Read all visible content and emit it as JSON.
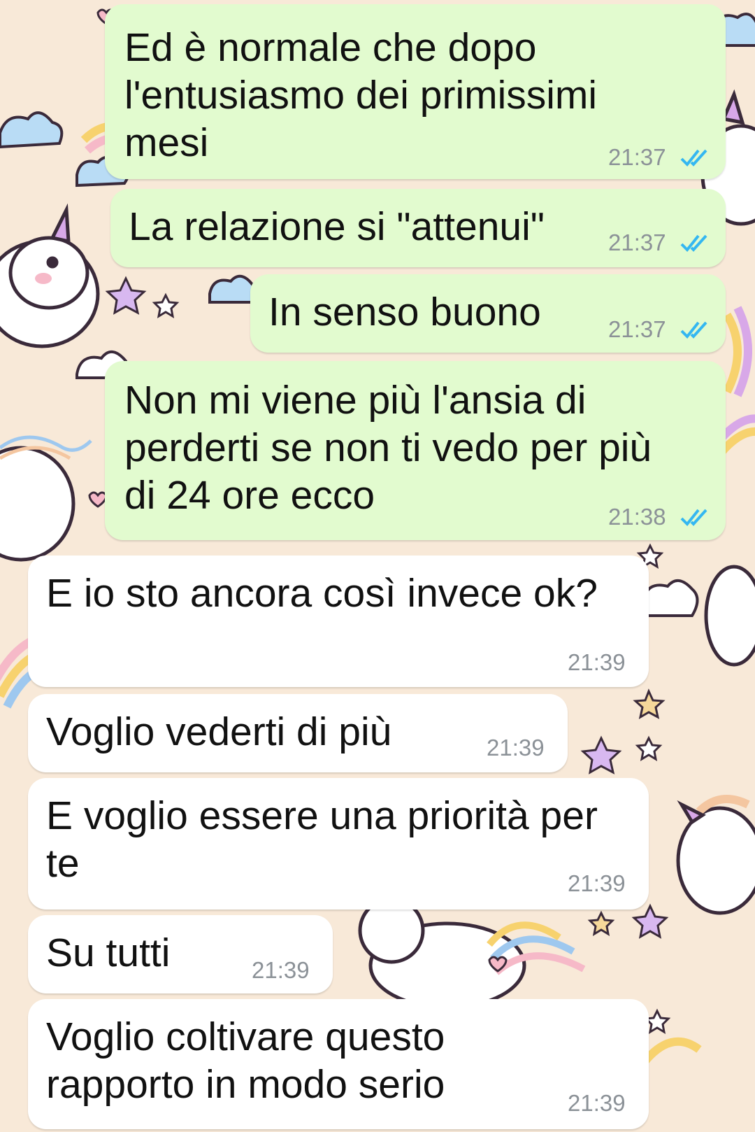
{
  "conversation": {
    "messages": [
      {
        "direction": "outgoing",
        "text": "Ed è normale che dopo\nl'entusiasmo dei primissimi\nmesi",
        "time": "21:37",
        "status": "read",
        "status_icon": "double-check-icon"
      },
      {
        "direction": "outgoing",
        "text": "La relazione si \"attenui\"",
        "time": "21:37",
        "status": "read",
        "status_icon": "double-check-icon"
      },
      {
        "direction": "outgoing",
        "text": "In senso buono",
        "time": "21:37",
        "status": "read",
        "status_icon": "double-check-icon"
      },
      {
        "direction": "outgoing",
        "text": "Non mi viene più l'ansia di\nperderti se non ti vedo per più\ndi 24 ore ecco",
        "time": "21:38",
        "status": "read",
        "status_icon": "double-check-icon"
      },
      {
        "direction": "incoming",
        "text": "E io sto ancora così invece ok?",
        "time": "21:39"
      },
      {
        "direction": "incoming",
        "text": "Voglio vederti di più",
        "time": "21:39"
      },
      {
        "direction": "incoming",
        "text": "E voglio essere una priorità per\nte",
        "time": "21:39"
      },
      {
        "direction": "incoming",
        "text": "Su tutti",
        "time": "21:39"
      },
      {
        "direction": "incoming",
        "text": "Voglio coltivare questo\nrapporto in modo serio",
        "time": "21:39"
      }
    ]
  },
  "colors": {
    "outgoing_bubble": "#e2fbcf",
    "incoming_bubble": "#ffffff",
    "read_ticks": "#34b7f1",
    "timestamp": "#8b9197",
    "wallpaper_base": "#f8e9d8"
  },
  "wallpaper": {
    "theme": "unicorn-pattern",
    "icons": [
      "unicorn-icon",
      "cloud-icon",
      "rainbow-icon",
      "star-icon",
      "heart-icon"
    ]
  }
}
